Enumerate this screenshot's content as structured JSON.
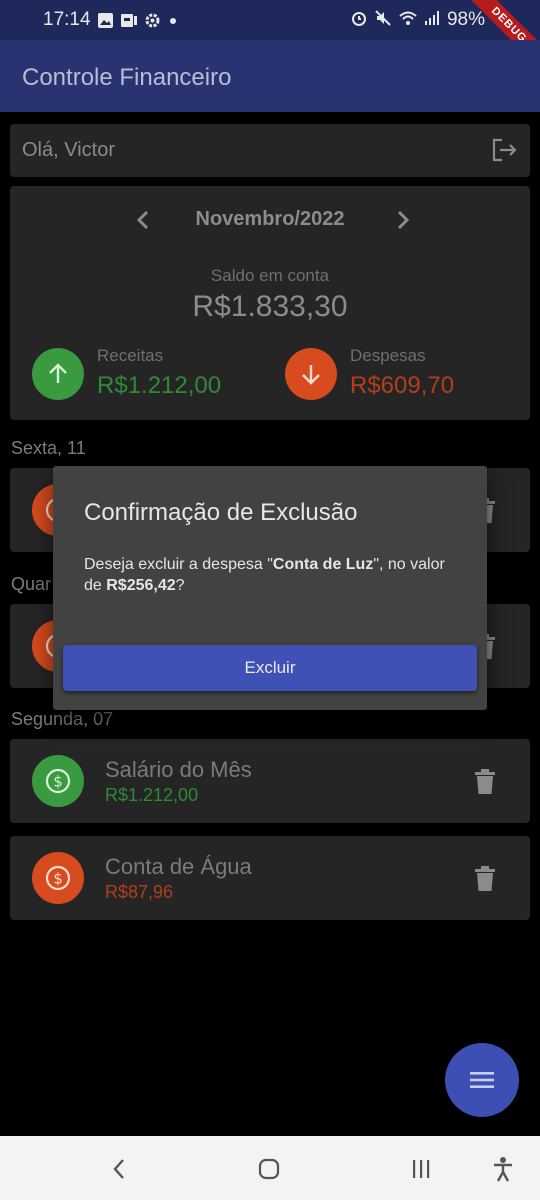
{
  "status_bar": {
    "time": "17:14",
    "battery": "98%",
    "debug_badge": "DEBUG",
    "left_icons": [
      "image-icon",
      "slides-icon",
      "settings-icon",
      "dot-icon"
    ],
    "right_icons": [
      "alarm-icon",
      "mute-icon",
      "wifi-icon",
      "signal-icon"
    ]
  },
  "app_bar": {
    "title": "Controle Financeiro"
  },
  "greeting": {
    "text": "Olá, Victor",
    "icon": "logout-icon"
  },
  "summary": {
    "month": "Novembro/2022",
    "balance_label": "Saldo em conta",
    "balance_value": "R$1.833,30",
    "income_label": "Receitas",
    "income_value": "R$1.212,00",
    "expense_label": "Despesas",
    "expense_value": "R$609,70"
  },
  "days": [
    {
      "header": "Sexta, 11"
    },
    {
      "header": "Quar"
    },
    {
      "header": "Segunda, 07",
      "transactions": [
        {
          "name": "Salário do Mês",
          "value": "R$1.212,00",
          "type": "income"
        },
        {
          "name": "Conta de Água",
          "value": "R$87,96",
          "type": "expense"
        }
      ]
    }
  ],
  "dialog": {
    "title": "Confirmação de Exclusão",
    "body_prefix": "Deseja excluir a despesa \"",
    "item_name": "Conta de Luz",
    "body_middle": "\", no valor de ",
    "item_value": "R$256,42",
    "body_suffix": "?",
    "confirm_button": "Excluir"
  },
  "colors": {
    "app_bar": "#2a3372",
    "income": "#3a9a3f",
    "expense": "#d84b1e",
    "accent": "#3f51b5"
  }
}
